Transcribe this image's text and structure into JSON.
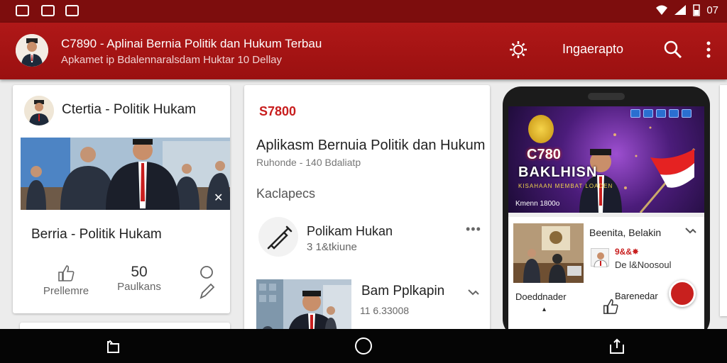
{
  "status_bar": {
    "time": "07"
  },
  "app_bar": {
    "title": "C7890 - Aplinai Bernia Politik dan Hukum Terbau",
    "subtitle": "Apkamet ip Bdalennaralsdam Huktar 10 Dellay",
    "action_text": "Ingaerapto"
  },
  "card_left": {
    "title": "Ctertia - Politik Hukam",
    "headline": "Berria - Politik Hukam",
    "stats": [
      {
        "value": "",
        "label": "Prellemre"
      },
      {
        "value": "50",
        "label": "Paulkans"
      }
    ]
  },
  "card_middle": {
    "code": "S7800",
    "title": "Aplikasm Bernuia Politik dan Hukum",
    "subtitle": "Ruhonde - 140 Bdaliatp",
    "section_label": "Kaclapecs",
    "row1": {
      "title": "Polikam Hukan",
      "subtitle": "3 1&tkiune",
      "more": "•••"
    },
    "row2": {
      "title": "Bam Pplkapin",
      "subtitle": "11 6.33008"
    }
  },
  "phone": {
    "banner": {
      "code": "C780",
      "title": "BAKLHISN",
      "tagline": "KISAHAAN MEMBAT LOADEN",
      "caption": "Kmenn 1800o"
    },
    "item": {
      "title": "Beenita, Belakin",
      "badge": "9&&✸",
      "badge_sub": "De l&Noosoul"
    },
    "footer_left": "Doeddnader",
    "footer_left_icon": "▴",
    "footer_right": "Barenedar"
  },
  "colors": {
    "primary": "#b01818",
    "status_bar": "#7d0d0d",
    "accent_text": "#c81e1e"
  },
  "icons": [
    "gear-icon",
    "search-icon",
    "more-vert-icon",
    "thumb-up-icon",
    "pencil-icon",
    "circle-icon",
    "syringe-icon",
    "share-icon",
    "nav-back-icon",
    "nav-home-icon",
    "nav-recent-icon"
  ]
}
